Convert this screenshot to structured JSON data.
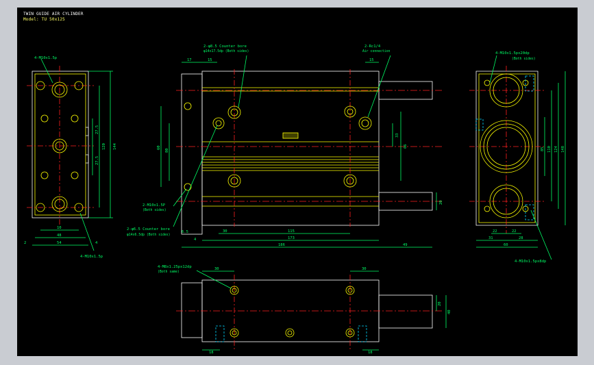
{
  "title": {
    "line1": "TWIN GUIDE AIR CYLINDER",
    "line2": "Model: TU 50x125"
  },
  "colors": {
    "background": "#000000",
    "frame": "#c9ccd2",
    "outline": "#ffffff",
    "feature": "#ffff00",
    "centerline": "#ff2020",
    "dimension": "#00ff66",
    "hidden": "#00d8ff"
  },
  "labels": {
    "left_top_note": "4-M10x1.5p",
    "left_bottom_note": "4-M10x1.5p",
    "front_counterbore_a": "2-φ8.5 Counter bore",
    "front_counterbore_b": "φ14x17.5dp (Both sides)",
    "front_port_a": "2-Rc1/4",
    "front_port_b": "Air connection",
    "front_lower_note_a": "2-M10x1.5P",
    "front_lower_note_b": "(Both sides)",
    "front_lower_cb_a": "2-φ6.5 Counter bore",
    "front_lower_cb_b": "φ14x6.5dp (Both sides)",
    "right_top_note_a": "4-M10x1.5px20dp",
    "right_top_note_b": "(Both sides)",
    "right_bottom_note": "4-M10x1.5px8dp",
    "bottom_note_a": "4-M8x1.25px12dp",
    "bottom_note_b": "(Both same)"
  },
  "dims": {
    "left": {
      "d10": "10",
      "d48": "48",
      "d54": "54",
      "d2": "2",
      "d4": "4",
      "d27_5a": "27.5",
      "d27_5b": "27.5",
      "d120": "120",
      "d144": "144"
    },
    "front": {
      "d17": "17",
      "d15a": "15",
      "d15b": "15",
      "d115": "115",
      "d173": "173",
      "d30": "30",
      "d186": "186",
      "d49": "49",
      "d6_5": "6.5",
      "d4": "4",
      "d60": "60",
      "d80": "80",
      "d33": "33",
      "d66": "66",
      "d20": "20"
    },
    "right": {
      "d22a": "22",
      "d22b": "22",
      "d31": "31",
      "d28": "28",
      "d60": "60",
      "d85": "85",
      "d110": "110",
      "d124": "124",
      "d148": "148"
    },
    "bottom": {
      "d30a": "30",
      "d30b": "30",
      "d18a": "18",
      "d18b": "18",
      "d20": "20",
      "d40": "40"
    }
  }
}
